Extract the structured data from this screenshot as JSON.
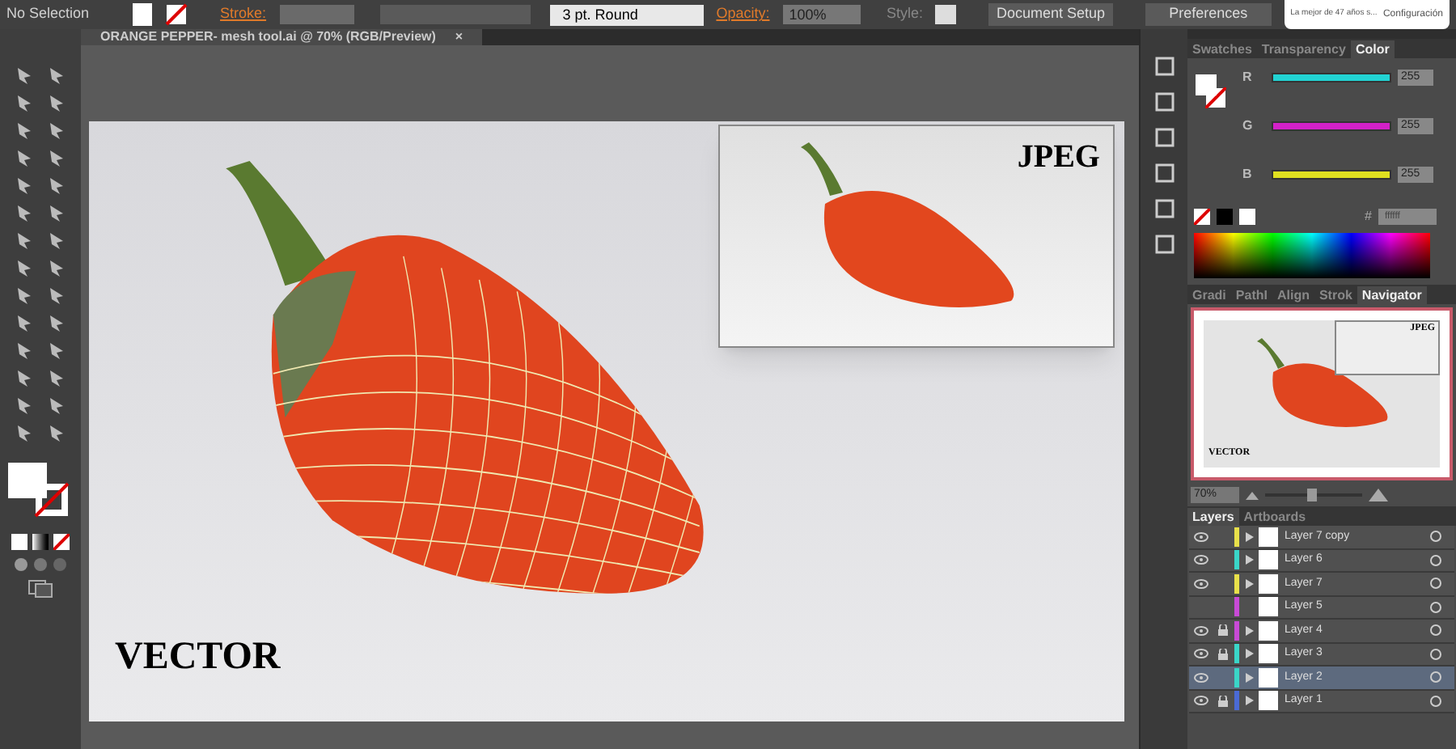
{
  "control_bar": {
    "selection": "No Selection",
    "stroke_label": "Stroke:",
    "brush": "3 pt. Round",
    "opacity_label": "Opacity:",
    "opacity": "100%",
    "style_label": "Style:",
    "buttons": [
      "Document Setup",
      "Preferences"
    ]
  },
  "notification": {
    "text": "La mejor de 47 años s...",
    "action": "Configuración"
  },
  "document_tab": {
    "title": "ORANGE PEPPER- mesh tool.ai @ 70% (RGB/Preview)",
    "close": "×"
  },
  "artboard": {
    "main_label": "VECTOR",
    "inset_label": "JPEG"
  },
  "color_panel": {
    "tabs": [
      {
        "label": "Swatches",
        "selected": false
      },
      {
        "label": "Transparency",
        "selected": false
      },
      {
        "label": "Color",
        "selected": true
      }
    ],
    "channels": [
      {
        "name": "R",
        "level": 1,
        "value": "255",
        "color": "#22d3d3"
      },
      {
        "name": "G",
        "level": 1,
        "value": "255",
        "color": "#d321c8"
      },
      {
        "name": "B",
        "level": 1,
        "value": "255",
        "color": "#e0e020"
      }
    ],
    "hex_label": "#",
    "hex": "ffffff"
  },
  "navigator_panel": {
    "tabs": [
      {
        "label": "Gradi",
        "selected": false
      },
      {
        "label": "PathI",
        "selected": false
      },
      {
        "label": "Align",
        "selected": false
      },
      {
        "label": "Strok",
        "selected": false
      },
      {
        "label": "Navigator",
        "selected": true
      }
    ],
    "thumb_labels": [
      "JPEG",
      "VECTOR"
    ],
    "zoom": "70%",
    "zoom_slider": {
      "level": 0.48
    }
  },
  "layers_panel": {
    "tabs": [
      {
        "label": "Layers",
        "selected": true
      },
      {
        "label": "Artboards",
        "selected": false
      }
    ],
    "layers": [
      {
        "name": "Layer 7 copy",
        "visible": true,
        "locked": false,
        "expandable": true,
        "selected": false,
        "color": "#e8e04a"
      },
      {
        "name": "Layer 6",
        "visible": true,
        "locked": false,
        "expandable": true,
        "selected": false,
        "color": "#3ad6c8"
      },
      {
        "name": "Layer 7",
        "visible": true,
        "locked": false,
        "expandable": true,
        "selected": false,
        "color": "#e8e04a"
      },
      {
        "name": "Layer 5",
        "visible": false,
        "locked": false,
        "expandable": false,
        "selected": false,
        "color": "#c84ad6"
      },
      {
        "name": "Layer 4",
        "visible": true,
        "locked": true,
        "expandable": true,
        "selected": false,
        "color": "#c84ad6"
      },
      {
        "name": "Layer 3",
        "visible": true,
        "locked": true,
        "expandable": true,
        "selected": false,
        "color": "#3ad6c8"
      },
      {
        "name": "Layer 2",
        "visible": true,
        "locked": false,
        "expandable": true,
        "selected": true,
        "color": "#3ad6c8"
      },
      {
        "name": "Layer 1",
        "visible": true,
        "locked": true,
        "expandable": true,
        "selected": false,
        "color": "#4a6ad6"
      }
    ]
  }
}
